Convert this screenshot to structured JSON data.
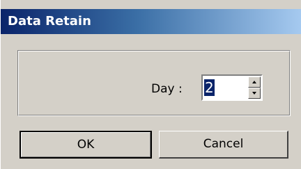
{
  "window": {
    "title": "Data Retain"
  },
  "form": {
    "day_label": "Day :",
    "day_value": "2"
  },
  "buttons": {
    "ok_label": "OK",
    "cancel_label": "Cancel"
  },
  "colors": {
    "dialog_face": "#d4d0c8",
    "titlebar_start": "#0a246a",
    "titlebar_end": "#a6caf0",
    "selection": "#0a246a"
  },
  "icons": {
    "spin_up": "arrow-up-icon",
    "spin_down": "arrow-down-icon"
  }
}
